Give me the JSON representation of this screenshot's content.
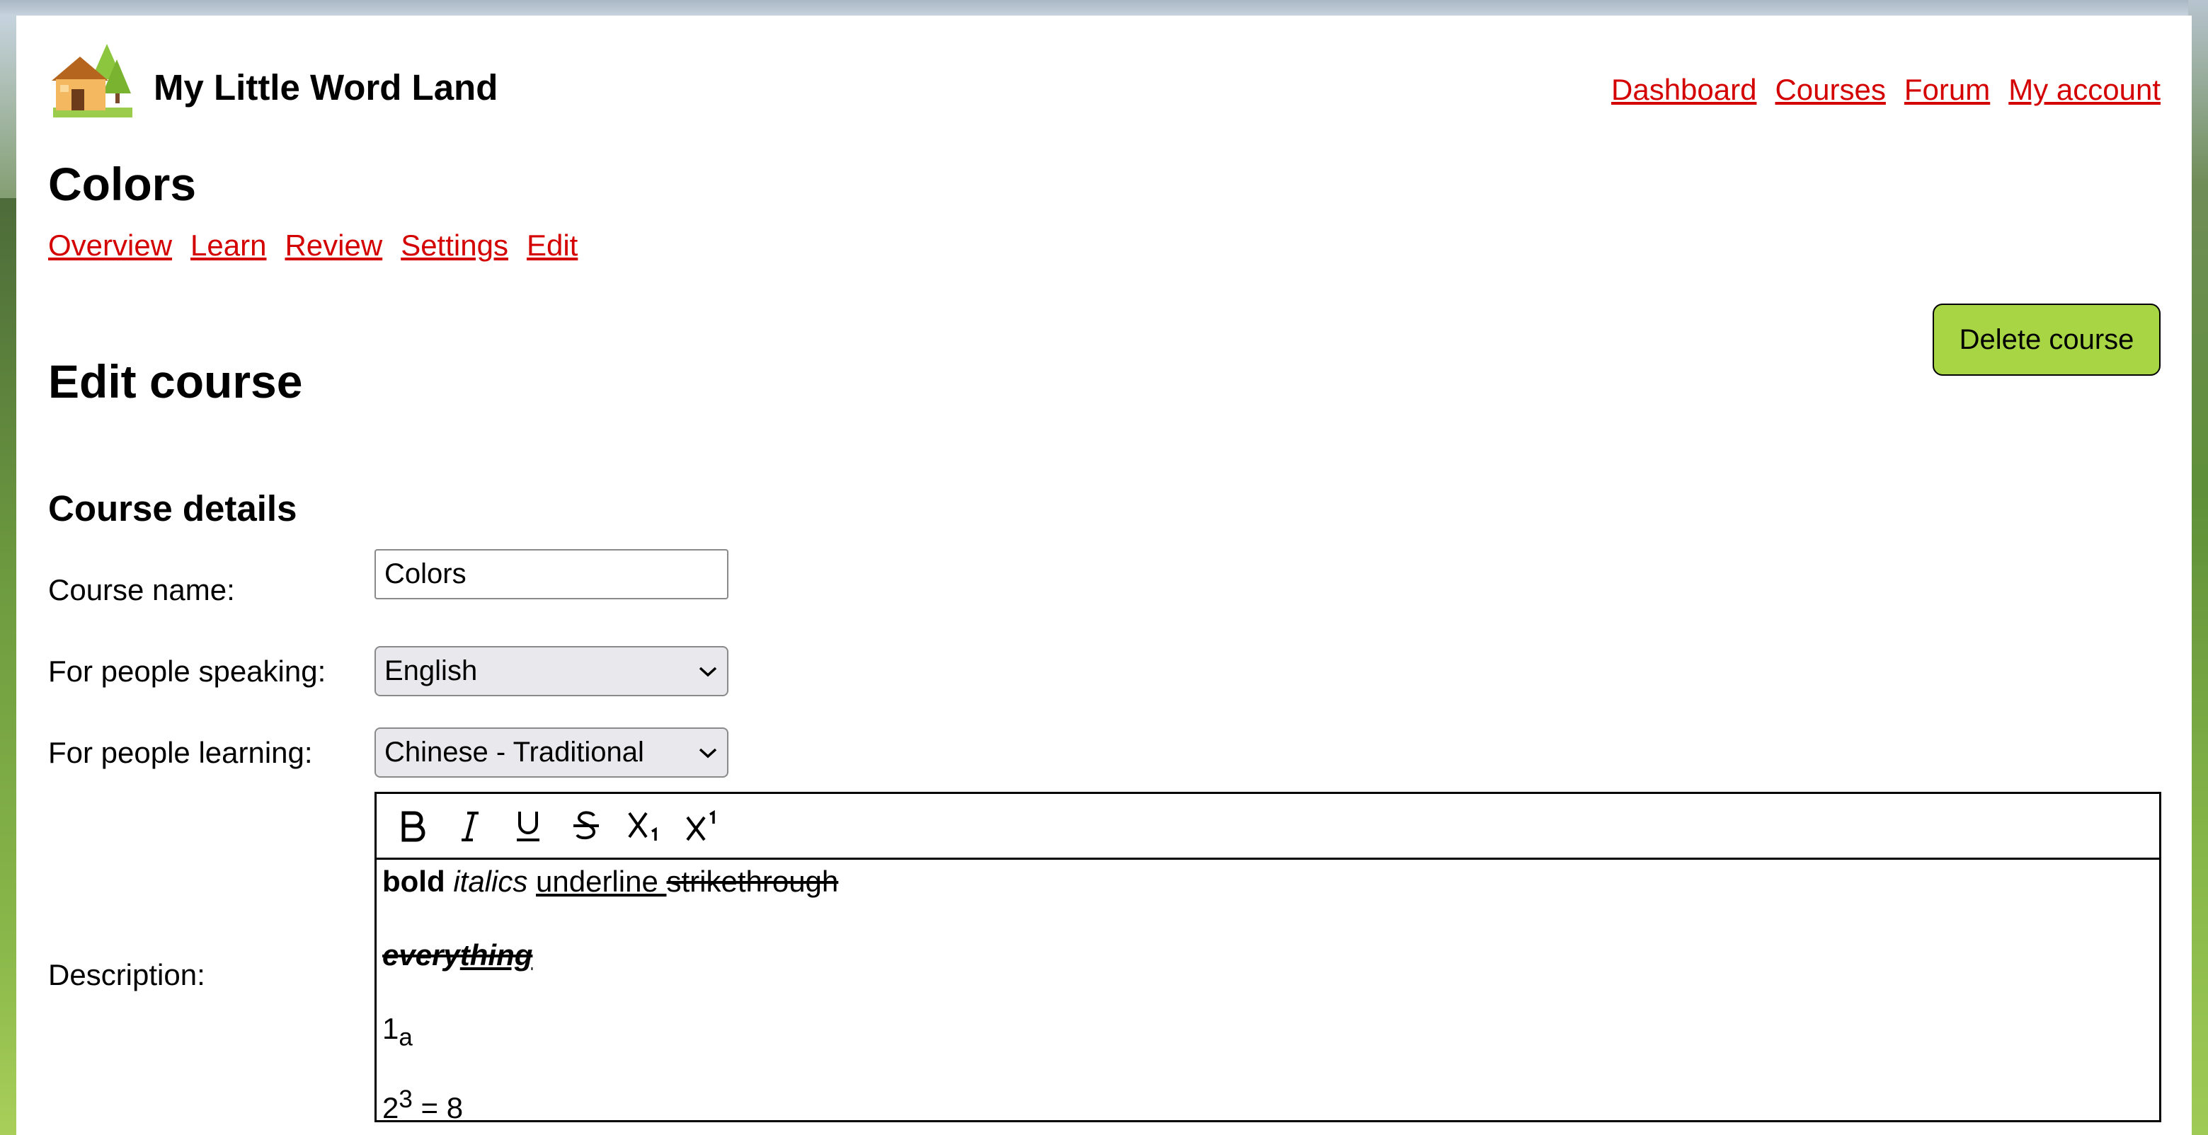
{
  "site": {
    "title": "My Little Word Land"
  },
  "topnav": {
    "dashboard": "Dashboard",
    "courses": "Courses",
    "forum": "Forum",
    "account": "My account"
  },
  "course": {
    "title": "Colors"
  },
  "subnav": {
    "overview": "Overview",
    "learn": "Learn",
    "review": "Review",
    "settings": "Settings",
    "edit": "Edit"
  },
  "page": {
    "heading": "Edit course",
    "delete_label": "Delete course"
  },
  "details": {
    "heading": "Course details",
    "name_label": "Course name:",
    "name_value": "Colors",
    "speaking_label": "For people speaking:",
    "speaking_value": "English",
    "learning_label": "For people learning:",
    "learning_value": "Chinese - Traditional",
    "description_label": "Description:"
  },
  "editor": {
    "toolbar": [
      "bold-icon",
      "italic-icon",
      "underline-icon",
      "strikethrough-icon",
      "subscript-icon",
      "superscript-icon"
    ],
    "line1": {
      "bold": "bold",
      "italic": "italics",
      "underline": "underline ",
      "strike": "strikethrough"
    },
    "line2": {
      "combo_a": "every",
      "combo_b": "thing"
    },
    "line3": {
      "base": "1",
      "sub": "a"
    },
    "line4": {
      "base": "2",
      "sup": "3",
      "rest": " = 8"
    }
  },
  "colors": {
    "link": "#d40000",
    "accent_button": "#a8d543"
  }
}
